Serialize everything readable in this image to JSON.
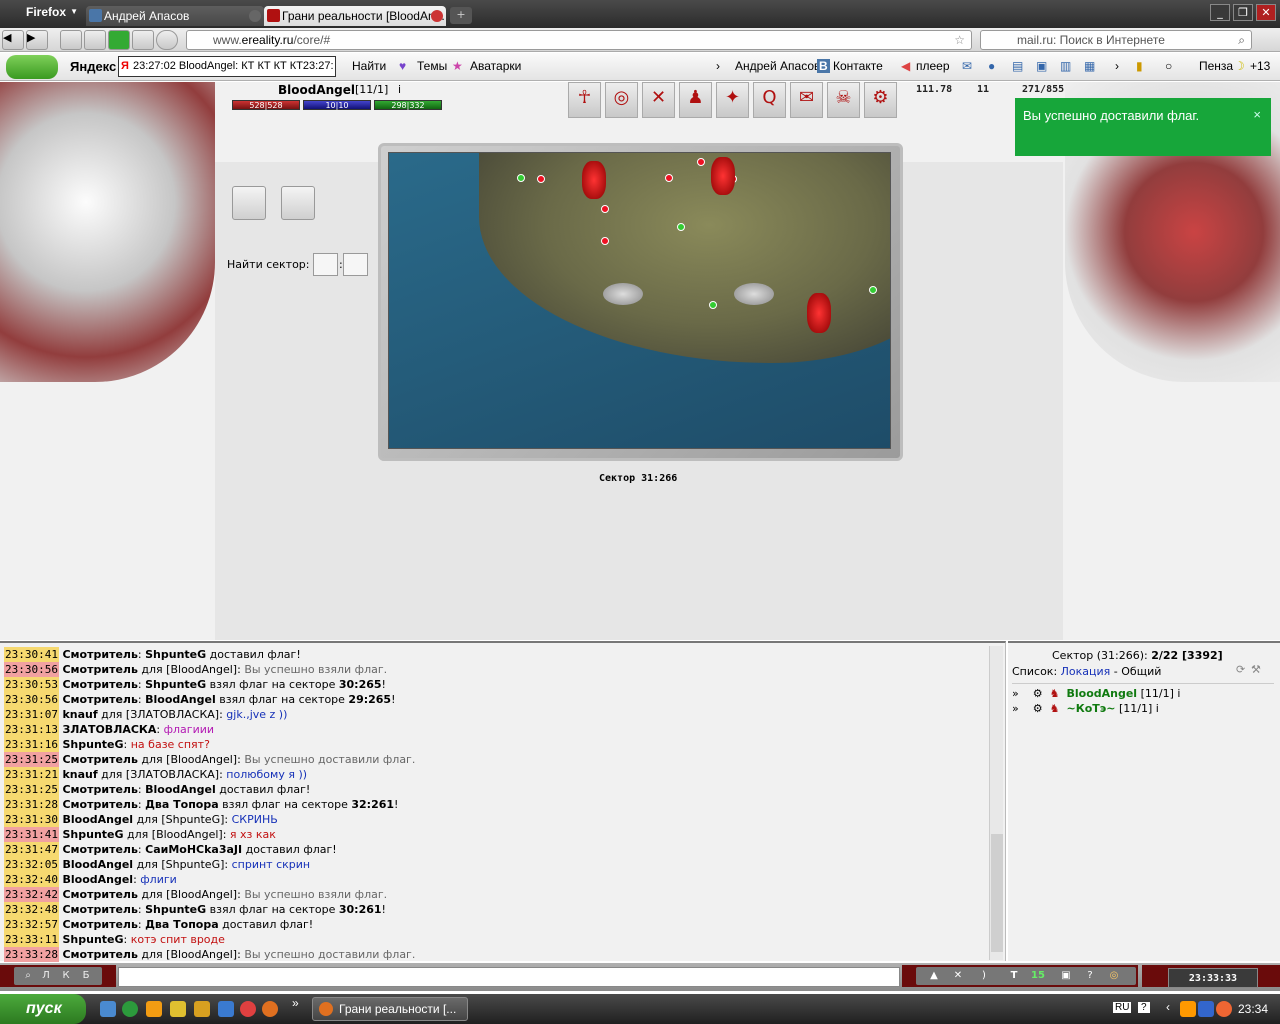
{
  "browser": {
    "app_button": "Firefox",
    "tabs": [
      {
        "label": "Андрей Апасов"
      },
      {
        "label": "Грани реальности [BloodAn..."
      }
    ],
    "url_prefix": "www.",
    "url_domain": "ereality.ru",
    "url_path": "/core/#",
    "search_placeholder": "mail.ru: Поиск в Интернете"
  },
  "yandex_bar": {
    "logo": "Яндекс",
    "search_value": "23:27:02 BloodAngel: КТ КТ КТ КТ23:27:",
    "find_button": "Найти",
    "themes": "Темы",
    "avatars": "Аватарки",
    "user": "Андрей Апасов",
    "vk": "Контакте",
    "player": "плеер",
    "city": "Пенза",
    "temp": "+13"
  },
  "game": {
    "player_name": "BloodAngel",
    "player_level": "[11/1]",
    "info_icon": "i",
    "hp": "528|528",
    "mp": "10|10",
    "ep": "298|332",
    "stat_money": "111.78",
    "stat_count": "11",
    "stat_weight": "271/855",
    "find_sector_label": "Найти сектор:",
    "sector_separator": ":",
    "sector_caption": "Сектор 31:266",
    "toast": "Вы успешно доставили флаг.",
    "toast_close": "×"
  },
  "chat": {
    "messages": [
      {
        "time": "23:30:41",
        "pvt": false,
        "parts": [
          {
            "t": "Смотритель",
            "c": "b"
          },
          {
            "t": ": "
          },
          {
            "t": "ShpunteG",
            "c": "b"
          },
          {
            "t": " доставил флаг!"
          }
        ]
      },
      {
        "time": "23:30:56",
        "pvt": true,
        "parts": [
          {
            "t": "Смотритель",
            "c": "b"
          },
          {
            "t": " для [BloodAngel]: "
          },
          {
            "t": "Вы успешно взяли флаг.",
            "c": "gray"
          }
        ]
      },
      {
        "time": "23:30:53",
        "pvt": false,
        "parts": [
          {
            "t": "Смотритель",
            "c": "b"
          },
          {
            "t": ": "
          },
          {
            "t": "ShpunteG",
            "c": "b"
          },
          {
            "t": " взял флаг на секторе "
          },
          {
            "t": "30:265",
            "c": "b"
          },
          {
            "t": "!"
          }
        ]
      },
      {
        "time": "23:30:56",
        "pvt": false,
        "parts": [
          {
            "t": "Смотритель",
            "c": "b"
          },
          {
            "t": ": "
          },
          {
            "t": "BloodAngel",
            "c": "b"
          },
          {
            "t": " взял флаг на секторе "
          },
          {
            "t": "29:265",
            "c": "b"
          },
          {
            "t": "!"
          }
        ]
      },
      {
        "time": "23:31:07",
        "pvt": false,
        "parts": [
          {
            "t": "knauf",
            "c": "b"
          },
          {
            "t": " для [ЗЛАТОВЛАСКА]: "
          },
          {
            "t": "gjk.,jve z ))",
            "c": "blue"
          }
        ]
      },
      {
        "time": "23:31:13",
        "pvt": false,
        "parts": [
          {
            "t": "ЗЛАТОВЛАСКА",
            "c": "b"
          },
          {
            "t": ": "
          },
          {
            "t": "флагиии",
            "c": "mag"
          }
        ]
      },
      {
        "time": "23:31:16",
        "pvt": false,
        "parts": [
          {
            "t": "ShpunteG",
            "c": "b"
          },
          {
            "t": ": "
          },
          {
            "t": "на базе спят?",
            "c": "red"
          }
        ]
      },
      {
        "time": "23:31:25",
        "pvt": true,
        "parts": [
          {
            "t": "Смотритель",
            "c": "b"
          },
          {
            "t": " для [BloodAngel]: "
          },
          {
            "t": "Вы успешно доставили флаг.",
            "c": "gray"
          }
        ]
      },
      {
        "time": "23:31:21",
        "pvt": false,
        "parts": [
          {
            "t": "knauf",
            "c": "b"
          },
          {
            "t": " для [ЗЛАТОВЛАСКА]: "
          },
          {
            "t": "полюбому я ))",
            "c": "blue"
          }
        ]
      },
      {
        "time": "23:31:25",
        "pvt": false,
        "parts": [
          {
            "t": "Смотритель",
            "c": "b"
          },
          {
            "t": ": "
          },
          {
            "t": "BloodAngel",
            "c": "b"
          },
          {
            "t": " доставил флаг!"
          }
        ]
      },
      {
        "time": "23:31:28",
        "pvt": false,
        "parts": [
          {
            "t": "Смотритель",
            "c": "b"
          },
          {
            "t": ": "
          },
          {
            "t": "Два Топора",
            "c": "b"
          },
          {
            "t": " взял флаг на секторе "
          },
          {
            "t": "32:261",
            "c": "b"
          },
          {
            "t": "!"
          }
        ]
      },
      {
        "time": "23:31:30",
        "pvt": false,
        "parts": [
          {
            "t": "BloodAngel",
            "c": "b"
          },
          {
            "t": " для [ShpunteG]: "
          },
          {
            "t": "СКРИНЬ",
            "c": "blue"
          }
        ]
      },
      {
        "time": "23:31:41",
        "pvt": true,
        "parts": [
          {
            "t": "ShpunteG",
            "c": "b"
          },
          {
            "t": " для [BloodAngel]: "
          },
          {
            "t": "я хз как",
            "c": "red"
          }
        ]
      },
      {
        "time": "23:31:47",
        "pvt": false,
        "parts": [
          {
            "t": "Смотритель",
            "c": "b"
          },
          {
            "t": ": "
          },
          {
            "t": "CaиMoHCka3aJI",
            "c": "b"
          },
          {
            "t": " доставил флаг!"
          }
        ]
      },
      {
        "time": "23:32:05",
        "pvt": false,
        "parts": [
          {
            "t": "BloodAngel",
            "c": "b"
          },
          {
            "t": " для [ShpunteG]: "
          },
          {
            "t": "спринт скрин",
            "c": "blue"
          }
        ]
      },
      {
        "time": "23:32:40",
        "pvt": false,
        "parts": [
          {
            "t": "BloodAngel",
            "c": "b"
          },
          {
            "t": ": "
          },
          {
            "t": "флиги",
            "c": "blue"
          }
        ]
      },
      {
        "time": "23:32:42",
        "pvt": true,
        "parts": [
          {
            "t": "Смотритель",
            "c": "b"
          },
          {
            "t": " для [BloodAngel]: "
          },
          {
            "t": "Вы успешно взяли флаг.",
            "c": "gray"
          }
        ]
      },
      {
        "time": "23:32:48",
        "pvt": false,
        "parts": [
          {
            "t": "Смотритель",
            "c": "b"
          },
          {
            "t": ": "
          },
          {
            "t": "ShpunteG",
            "c": "b"
          },
          {
            "t": " взял флаг на секторе "
          },
          {
            "t": "30:261",
            "c": "b"
          },
          {
            "t": "!"
          }
        ]
      },
      {
        "time": "23:32:57",
        "pvt": false,
        "parts": [
          {
            "t": "Смотритель",
            "c": "b"
          },
          {
            "t": ": "
          },
          {
            "t": "Два Топора",
            "c": "b"
          },
          {
            "t": " доставил флаг!"
          }
        ]
      },
      {
        "time": "23:33:11",
        "pvt": false,
        "parts": [
          {
            "t": "ShpunteG",
            "c": "b"
          },
          {
            "t": ": "
          },
          {
            "t": "котэ спит вроде",
            "c": "red"
          }
        ]
      },
      {
        "time": "23:33:28",
        "pvt": true,
        "parts": [
          {
            "t": "Смотритель",
            "c": "b"
          },
          {
            "t": " для [BloodAngel]: "
          },
          {
            "t": "Вы успешно доставили флаг.",
            "c": "gray"
          }
        ]
      }
    ],
    "toolbar_left": [
      "Л",
      "К",
      "Б"
    ],
    "toolbar_right": [
      ")",
      "T",
      "15",
      "?"
    ],
    "clock": "23:33:33"
  },
  "users": {
    "sector_header": "Сектор (31:266): ",
    "sector_count": "2/22 [3392]",
    "list_label": "Список: ",
    "list_location": "Локация",
    "list_sep": " - ",
    "list_common": "Общий",
    "list": [
      {
        "name": "BloodAngel",
        "level": "[11/1]"
      },
      {
        "name": "~КоТэ~",
        "level": "[11/1]"
      }
    ]
  },
  "taskbar": {
    "start": "пуск",
    "item": "Грани реальности [...",
    "lang": "RU",
    "time": "23:34"
  }
}
